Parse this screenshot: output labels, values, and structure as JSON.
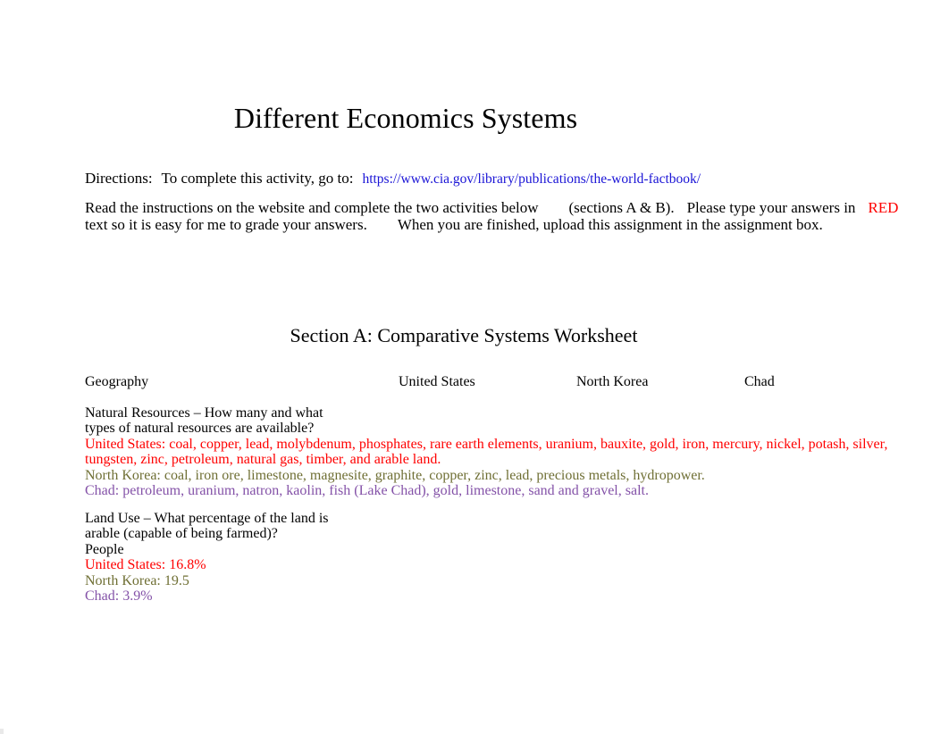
{
  "document": {
    "title": "Different Economics Systems",
    "directions": {
      "label": "Directions:",
      "text": "To complete this activity, go to:",
      "url": "https://www.cia.gov/library/publications/the-world-factbook/"
    },
    "instructions": {
      "line1_a": "Read the instructions on the website and complete the two activities below",
      "line1_b": "(sections A & B).",
      "line1_c": "Please type your answers in",
      "line1_highlight": "RED",
      "line2_a": "text so it is easy for me to grade your answers.",
      "line2_b": "When you are finished, upload this assignment in the assignment box."
    },
    "section": {
      "heading": "Section A: Comparative Systems Worksheet"
    },
    "table": {
      "headers": {
        "category": "Geography",
        "country1": "United States",
        "country2": "North Korea",
        "country3": "Chad"
      },
      "rows": [
        {
          "question_line1": "Natural Resources – How many and what",
          "question_line2": "types of natural resources are available?",
          "answer_us_line1": "United States: coal, copper, lead, molybdenum, phosphates, rare earth elements, uranium, bauxite, gold, iron, mercury, nickel, potash, silver,",
          "answer_us_line2": "tungsten, zinc, petroleum, natural gas, timber, and arable land.",
          "answer_nk": "North Korea: coal, iron ore, limestone, magnesite, graphite, copper, zinc, lead, precious metals, hydropower.",
          "answer_cd": "Chad: petroleum, uranium, natron, kaolin, fish (Lake Chad), gold, limestone, sand and gravel, salt."
        },
        {
          "question_line1": "Land Use – What percentage of the land is",
          "question_line2": "arable (capable of being farmed)?",
          "question_line3": "People",
          "answer_us": "United States: 16.8%",
          "answer_nk": "North Korea: 19.5",
          "answer_cd": "Chad: 3.9%"
        }
      ]
    },
    "colors": {
      "answer_us": "#ff0000",
      "answer_nk": "#6f6f34",
      "answer_cd": "#8452a8",
      "link": "#1a14d6",
      "text": "#000000",
      "background": "#ffffff"
    }
  }
}
